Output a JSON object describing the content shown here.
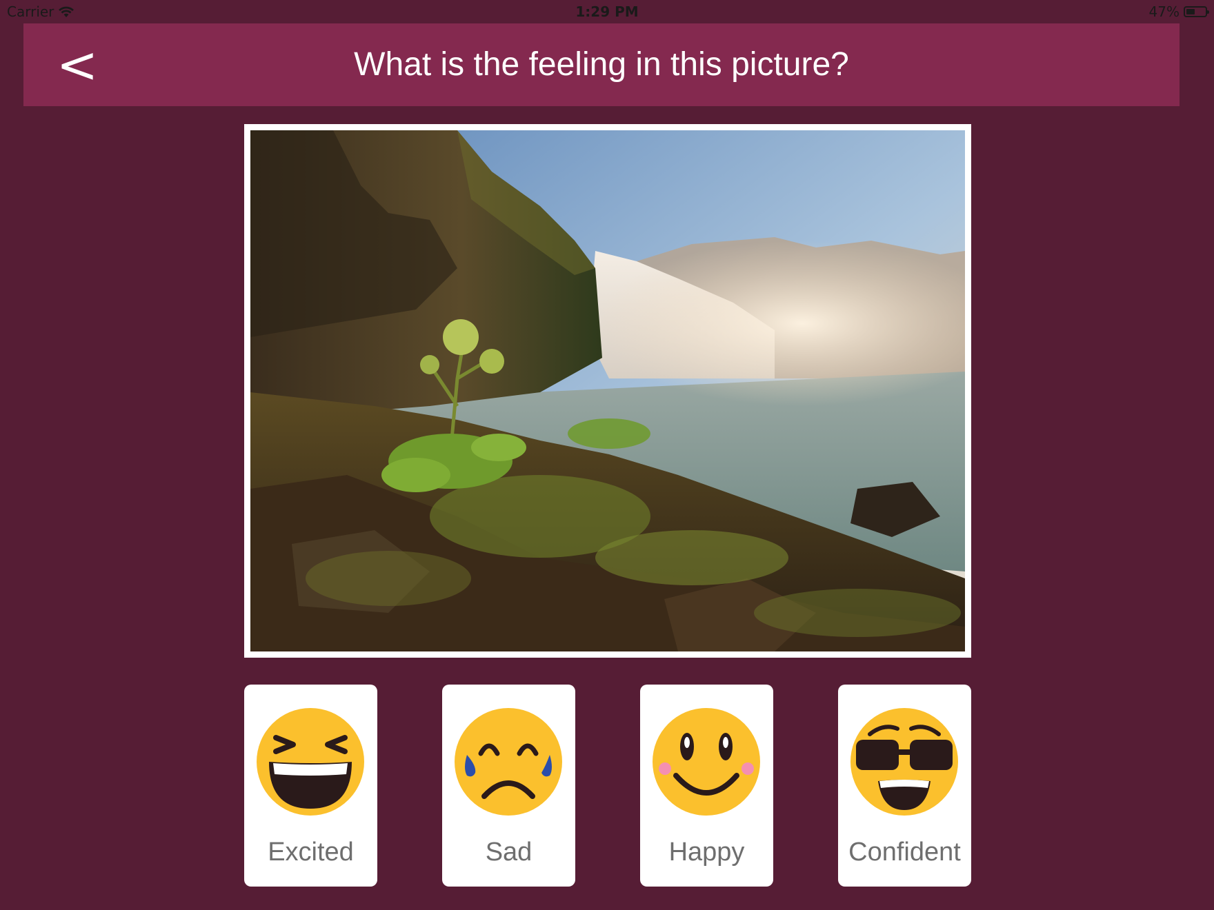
{
  "status_bar": {
    "carrier": "Carrier",
    "time": "1:29 PM",
    "battery_percent": "47%",
    "battery_level": 0.47
  },
  "header": {
    "back_label": "<",
    "title": "What is the feeling in this picture?"
  },
  "picture": {
    "subject": "waterfall landscape with mossy rocks and plants"
  },
  "choices": [
    {
      "label": "Excited",
      "icon": "excited-face-icon"
    },
    {
      "label": "Sad",
      "icon": "sad-face-icon"
    },
    {
      "label": "Happy",
      "icon": "happy-face-icon"
    },
    {
      "label": "Confident",
      "icon": "confident-face-icon"
    }
  ],
  "colors": {
    "background": "#561d35",
    "header": "#84294f",
    "emoji_yellow": "#fbc02d"
  }
}
